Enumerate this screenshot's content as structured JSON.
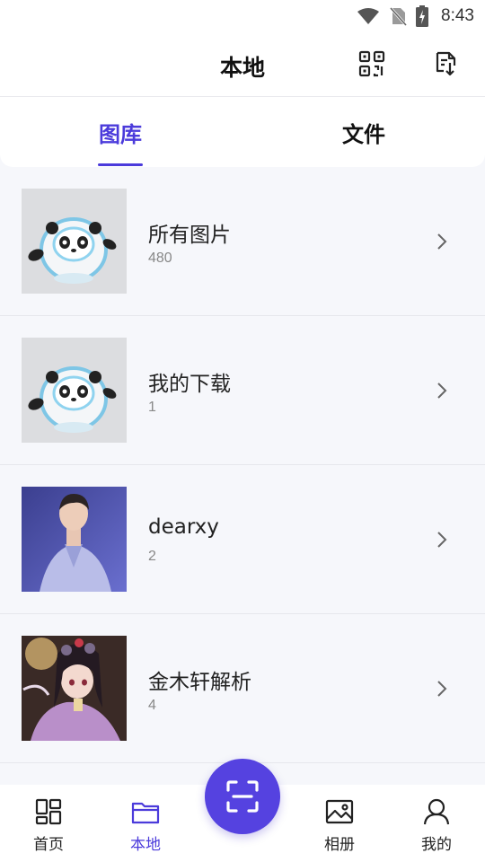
{
  "status_bar": {
    "time": "8:43",
    "icons": [
      "wifi-icon",
      "no-sim-icon",
      "battery-charging-icon"
    ]
  },
  "header": {
    "title": "本地",
    "actions": [
      "qr-code-icon",
      "export-icon"
    ]
  },
  "tabs": [
    {
      "label": "图库",
      "active": true
    },
    {
      "label": "文件",
      "active": false
    }
  ],
  "albums": [
    {
      "name": "所有图片",
      "count": "480",
      "thumb": "panda-mascot"
    },
    {
      "name": "我的下载",
      "count": "1",
      "thumb": "panda-mascot"
    },
    {
      "name": "dearxy",
      "count": "2",
      "thumb": "person-photo"
    },
    {
      "name": "金木轩解析",
      "count": "4",
      "thumb": "anime-art"
    }
  ],
  "bottom_nav": [
    {
      "label": "首页",
      "icon": "grid-icon",
      "active": false
    },
    {
      "label": "本地",
      "icon": "folder-icon",
      "active": true
    },
    {
      "label": "相册",
      "icon": "image-icon",
      "active": false
    },
    {
      "label": "我的",
      "icon": "user-icon",
      "active": false
    }
  ],
  "fab": {
    "icon": "scan-icon"
  },
  "colors": {
    "accent": "#4b3bdb",
    "fab": "#5542e0",
    "background": "#f6f7fb"
  }
}
